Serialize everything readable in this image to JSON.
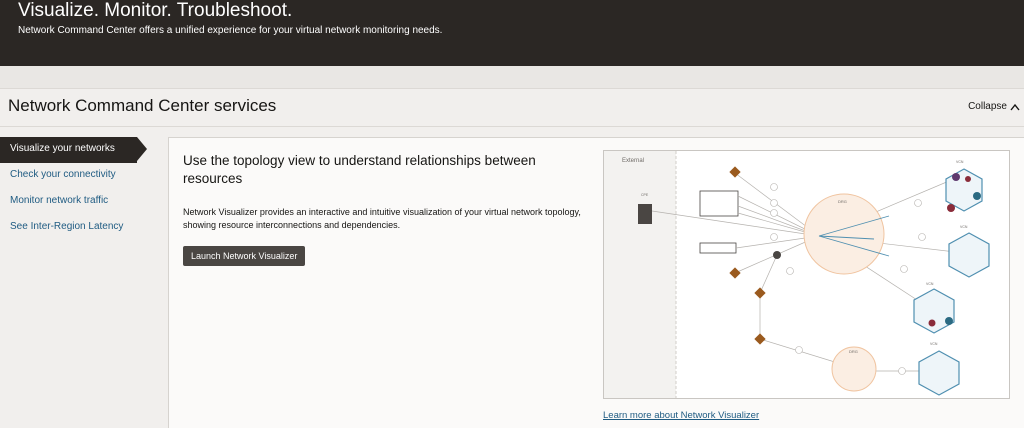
{
  "hero": {
    "title": "Visualize. Monitor. Troubleshoot.",
    "subtitle": "Network Command Center offers a unified experience for your virtual network monitoring needs."
  },
  "section": {
    "title": "Network Command Center services",
    "collapse_label": "Collapse"
  },
  "nav": {
    "items": [
      {
        "label": "Visualize your networks",
        "active": true
      },
      {
        "label": "Check your connectivity",
        "active": false
      },
      {
        "label": "Monitor network traffic",
        "active": false
      },
      {
        "label": "See Inter-Region Latency",
        "active": false
      }
    ]
  },
  "panel": {
    "heading": "Use the topology view to understand relationships between resources",
    "description": "Network Visualizer provides an interactive and intuitive visualization of your virtual network topology, showing resource interconnections and dependencies.",
    "button_label": "Launch Network Visualizer",
    "link_label": "Learn more about Network Visualizer"
  },
  "diagram": {
    "external_label": "External",
    "drg_labels": [
      "DRG",
      "DRG"
    ],
    "node_labels": [
      "VCN",
      "VCN",
      "VCN",
      "VCN"
    ],
    "small_labels": [
      "CPE",
      "CPE"
    ],
    "colors": {
      "drg_fill": "#fbeee3",
      "drg_stroke": "#f0c4a0",
      "vcn_stroke": "#4f8fb0",
      "vcn_fill": "#eef5f9",
      "diamond": "#9a5a1e",
      "dot_purple": "#5f3a6e",
      "dot_teal": "#2b6a82",
      "dot_red": "#8a2c3a",
      "line": "#b5b2ae"
    }
  }
}
